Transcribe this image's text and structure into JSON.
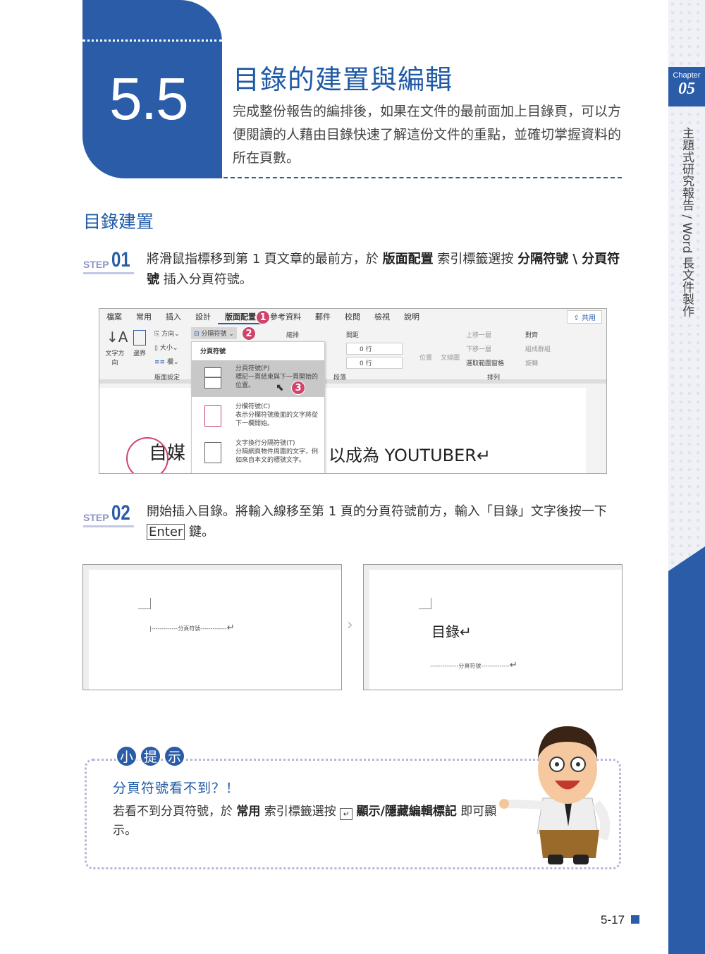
{
  "header": {
    "section_number": "5.5",
    "title": "目錄的建置與編輯",
    "intro": "完成整份報告的編排後，如果在文件的最前面加上目錄頁，可以方便閱讀的人藉由目錄快速了解這份文件的重點，並確切掌握資料的所在頁數。"
  },
  "section": {
    "heading": "目錄建置"
  },
  "steps": [
    {
      "label": "STEP",
      "number": "01",
      "parts": [
        "將滑鼠指標移到第 1 頁文章的最前方，於 ",
        "版面配置",
        " 索引標籤選按 ",
        "分隔符號 \\ 分頁符號",
        " 插入分頁符號。"
      ]
    },
    {
      "label": "STEP",
      "number": "02",
      "parts": [
        "開始插入目錄。將輸入線移至第 1 頁的分頁符號前方，輸入「目錄」文字後按一下 ",
        "Enter",
        " 鍵。"
      ]
    }
  ],
  "word": {
    "tabs": [
      "檔案",
      "常用",
      "插入",
      "設計",
      "版面配置",
      "參考資料",
      "郵件",
      "校閱",
      "檢視",
      "說明"
    ],
    "active_tab": "版面配置",
    "share": "共用",
    "ribbon": {
      "text_dir": "文字方向",
      "margins": "邊界",
      "orientation": "方向",
      "size": "大小",
      "columns": "欄",
      "breaks": "分隔符號",
      "indent": "縮排",
      "spacing": "間距",
      "spacing_before": "0 行",
      "spacing_after": "0 行",
      "group_page_setup": "版面設定",
      "group_paragraph": "段落",
      "position": "位置",
      "wrap": "文繞圖",
      "bring_forward": "上移一層",
      "send_backward": "下移一層",
      "selection_pane": "選取範圍窗格",
      "align": "對齊",
      "group": "組成群組",
      "rotate": "旋轉",
      "group_arrange": "排列"
    },
    "menu": {
      "header": "分頁符號",
      "items": [
        {
          "title": "分頁符號(P)",
          "desc": "標記一頁結束與下一頁開始的位置。"
        },
        {
          "title": "分欄符號(C)",
          "desc": "表示分欄符號後面的文字將從下一欄開始。"
        },
        {
          "title": "文字換行分隔符號(T)",
          "desc": "分隔網頁物件周圍的文字，例如來自本文的標號文字。"
        }
      ]
    },
    "doc_text_left": "自媒",
    "doc_text_right": "以成為  YOUTUBER↵",
    "callouts": [
      "1",
      "2",
      "3"
    ]
  },
  "compare": {
    "page_break_label": "分頁符號",
    "before_mark": "↵",
    "after_text": "目錄↵"
  },
  "tip": {
    "badge": [
      "小",
      "提",
      "示"
    ],
    "heading": "分頁符號看不到？！",
    "parts": [
      "若看不到分頁符號，於 ",
      "常用",
      " 索引標籤選按 ",
      "顯示/隱藏編輯標記",
      " 即可顯示。"
    ]
  },
  "sidebar": {
    "chapter_label": "Chapter",
    "chapter_number": "05",
    "book_title": "主題式研究報告 / Word 長文件製作"
  },
  "page_number": "5-17",
  "colors": {
    "brand_blue": "#2a5ca8",
    "callout_pink": "#d0436a"
  }
}
